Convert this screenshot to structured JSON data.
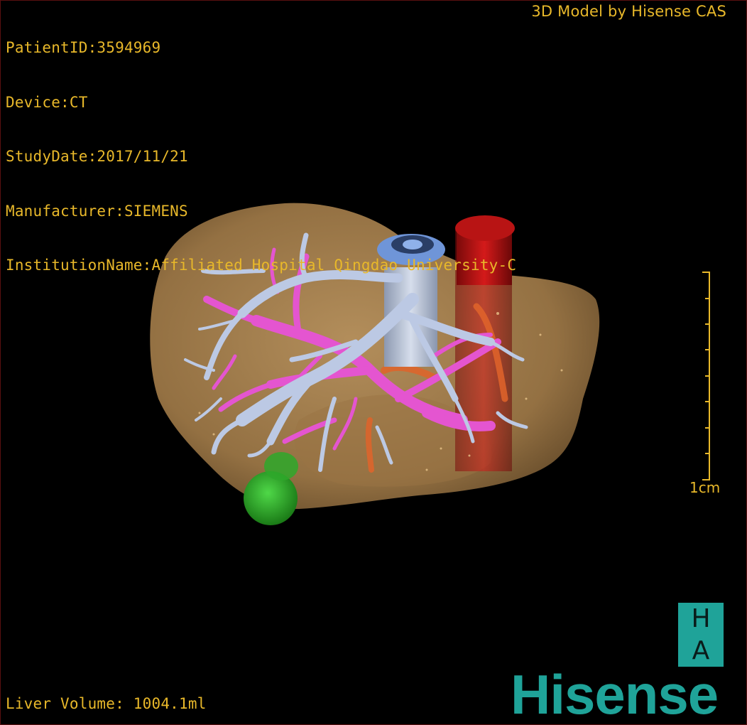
{
  "header": {
    "info_lines": [
      "PatientID:3594969",
      "Device:CT",
      "StudyDate:2017/11/21",
      "Manufacturer:SIEMENS",
      "InstitutionName:Affiliated Hospital Qingdao University-C"
    ],
    "credit": "3D Model by Hisense CAS"
  },
  "footer": {
    "volume": "Liver Volume: 1004.1ml"
  },
  "scale": {
    "label": "1cm"
  },
  "logo": {
    "letter_top": "H",
    "letter_bottom": "A",
    "brand": "Hisense"
  },
  "colors": {
    "text": "#e8b82a",
    "liver": "#b08a55",
    "hepatic_vein": "#b7c4e0",
    "portal_vein": "#e455d0",
    "ivc": "#7fa8e8",
    "aorta": "#c01818",
    "tumor": "#2fb52a",
    "brand": "#1fa399"
  },
  "icons": [
    "liver-model",
    "hepatic-vein-tree",
    "portal-vein-tree",
    "aorta-cylinder",
    "tumor-lesion"
  ]
}
